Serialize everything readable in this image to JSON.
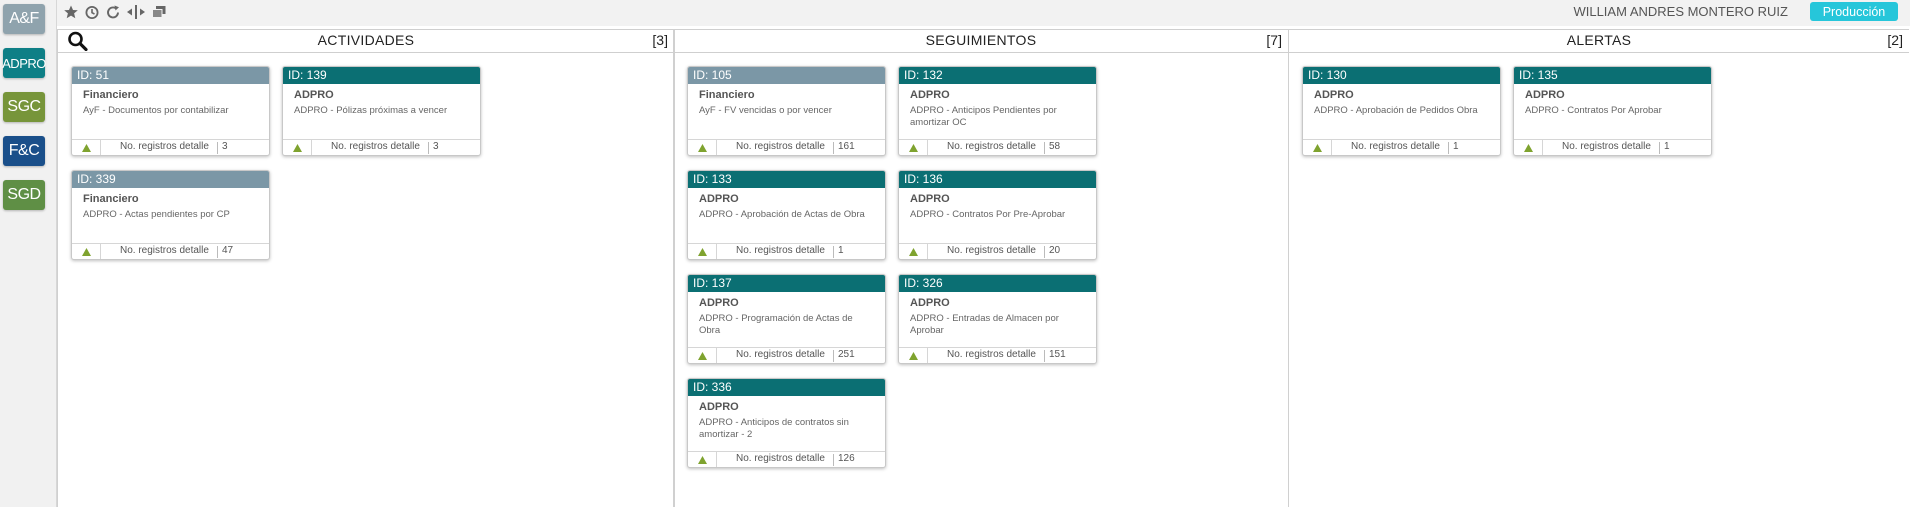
{
  "sidebar": {
    "buttons": [
      {
        "label": "A&F",
        "color": "#8fa3ad"
      },
      {
        "label": "ADPRO",
        "color": "#0e7f86"
      },
      {
        "label": "SGC",
        "color": "#77953a"
      },
      {
        "label": "F&C",
        "color": "#1a4f8a"
      },
      {
        "label": "SGD",
        "color": "#5f8f45"
      }
    ]
  },
  "toolbar": {
    "icons": [
      "star-icon",
      "history-icon",
      "refresh-icon",
      "split-columns-icon",
      "windows-icon"
    ]
  },
  "header": {
    "user": "WILLIAM ANDRES MONTERO RUIZ",
    "environment": "Producción"
  },
  "columns": [
    {
      "title": "ACTIVIDADES",
      "count": "[3]",
      "cards": [
        {
          "id": "ID: 51",
          "style": "grey",
          "category": "Financiero",
          "description": "AyF - Documentos por contabilizar",
          "footer_label": "No. registros detalle",
          "count": "3"
        },
        {
          "id": "ID: 139",
          "style": "teal",
          "category": "ADPRO",
          "description": "ADPRO - Pólizas próximas a vencer",
          "footer_label": "No. registros detalle",
          "count": "3"
        },
        {
          "id": "ID: 339",
          "style": "grey",
          "category": "Financiero",
          "description": "ADPRO - Actas pendientes por CP",
          "footer_label": "No. registros detalle",
          "count": "47"
        }
      ]
    },
    {
      "title": "SEGUIMIENTOS",
      "count": "[7]",
      "cards": [
        {
          "id": "ID: 105",
          "style": "grey",
          "category": "Financiero",
          "description": "AyF - FV vencidas o por vencer",
          "footer_label": "No. registros detalle",
          "count": "161"
        },
        {
          "id": "ID: 132",
          "style": "teal",
          "category": "ADPRO",
          "description": "ADPRO - Anticipos Pendientes por amortizar OC",
          "footer_label": "No. registros detalle",
          "count": "58"
        },
        {
          "id": "ID: 133",
          "style": "teal",
          "category": "ADPRO",
          "description": "ADPRO - Aprobación de Actas de Obra",
          "footer_label": "No. registros detalle",
          "count": "1"
        },
        {
          "id": "ID: 136",
          "style": "teal",
          "category": "ADPRO",
          "description": "ADPRO - Contratos Por Pre-Aprobar",
          "footer_label": "No. registros detalle",
          "count": "20"
        },
        {
          "id": "ID: 137",
          "style": "teal",
          "category": "ADPRO",
          "description": "ADPRO - Programación de Actas de Obra",
          "footer_label": "No. registros detalle",
          "count": "251"
        },
        {
          "id": "ID: 326",
          "style": "teal",
          "category": "ADPRO",
          "description": "ADPRO - Entradas de Almacen por Aprobar",
          "footer_label": "No. registros detalle",
          "count": "151"
        },
        {
          "id": "ID: 336",
          "style": "teal",
          "category": "ADPRO",
          "description": "ADPRO - Anticipos de contratos sin amortizar - 2",
          "footer_label": "No. registros detalle",
          "count": "126"
        }
      ]
    },
    {
      "title": "ALERTAS",
      "count": "[2]",
      "cards": [
        {
          "id": "ID: 130",
          "style": "teal",
          "category": "ADPRO",
          "description": "ADPRO - Aprobación de Pedidos Obra",
          "footer_label": "No. registros detalle",
          "count": "1"
        },
        {
          "id": "ID: 135",
          "style": "teal",
          "category": "ADPRO",
          "description": "ADPRO - Contratos Por Aprobar",
          "footer_label": "No. registros detalle",
          "count": "1"
        }
      ]
    }
  ]
}
